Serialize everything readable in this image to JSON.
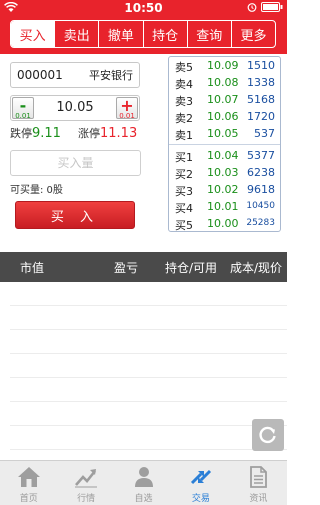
{
  "status_bar": {
    "time": "10:50"
  },
  "tabs": [
    {
      "label": "买入",
      "active": true
    },
    {
      "label": "卖出",
      "active": false
    },
    {
      "label": "撤单",
      "active": false
    },
    {
      "label": "持仓",
      "active": false
    },
    {
      "label": "查询",
      "active": false
    },
    {
      "label": "更多",
      "active": false
    }
  ],
  "trade": {
    "stock_code": "000001",
    "stock_name": "平安银行",
    "minus_label": "-",
    "plus_label": "+",
    "step": "0.01",
    "price": "10.05",
    "limit_down_label": "跌停",
    "limit_down": "9.11",
    "limit_up_label": "涨停",
    "limit_up": "11.13",
    "qty_placeholder": "买入量",
    "buyable_label": "可买量: 0股",
    "buy_button": "买 入"
  },
  "order_book": {
    "sell": [
      {
        "label": "卖5",
        "price": "10.09",
        "volume": "1510"
      },
      {
        "label": "卖4",
        "price": "10.08",
        "volume": "1338"
      },
      {
        "label": "卖3",
        "price": "10.07",
        "volume": "5168"
      },
      {
        "label": "卖2",
        "price": "10.06",
        "volume": "1720"
      },
      {
        "label": "卖1",
        "price": "10.05",
        "volume": "537"
      }
    ],
    "buy": [
      {
        "label": "买1",
        "price": "10.04",
        "volume": "5377"
      },
      {
        "label": "买2",
        "price": "10.03",
        "volume": "6238"
      },
      {
        "label": "买3",
        "price": "10.02",
        "volume": "9618"
      },
      {
        "label": "买4",
        "price": "10.01",
        "volume": "10450"
      },
      {
        "label": "买5",
        "price": "10.00",
        "volume": "25283"
      }
    ]
  },
  "positions": {
    "headers": [
      "市值",
      "盈亏",
      "持仓/可用",
      "成本/现价"
    ]
  },
  "bottom_nav": [
    {
      "label": "首页",
      "icon": "home-icon",
      "active": false
    },
    {
      "label": "行情",
      "icon": "trend-icon",
      "active": false
    },
    {
      "label": "自选",
      "icon": "person-icon",
      "active": false
    },
    {
      "label": "交易",
      "icon": "trade-icon",
      "active": true
    },
    {
      "label": "资讯",
      "icon": "news-icon",
      "active": false
    }
  ],
  "colors": {
    "brand_red": "#e8232c",
    "rise_red": "#e8232c",
    "fall_green": "#1a8f1a",
    "volume_blue": "#1a4fa0",
    "active_blue": "#2b7fd6"
  }
}
